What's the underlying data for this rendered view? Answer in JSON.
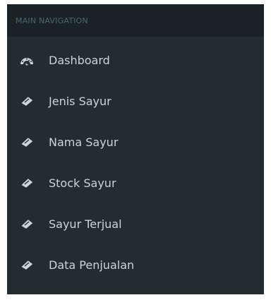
{
  "sidebar": {
    "header": "MAIN NAVIGATION",
    "items": [
      {
        "label": "Dashboard",
        "icon": "dashboard-icon"
      },
      {
        "label": "Jenis Sayur",
        "icon": "ticket-icon"
      },
      {
        "label": "Nama Sayur",
        "icon": "ticket-icon"
      },
      {
        "label": "Stock Sayur",
        "icon": "ticket-icon"
      },
      {
        "label": "Sayur Terjual",
        "icon": "ticket-icon"
      },
      {
        "label": "Data Penjualan",
        "icon": "ticket-icon"
      }
    ],
    "colors": {
      "background": "#222d32",
      "header_background": "#1a2226",
      "header_text": "#4b646f",
      "item_text": "#c9d5da"
    }
  }
}
